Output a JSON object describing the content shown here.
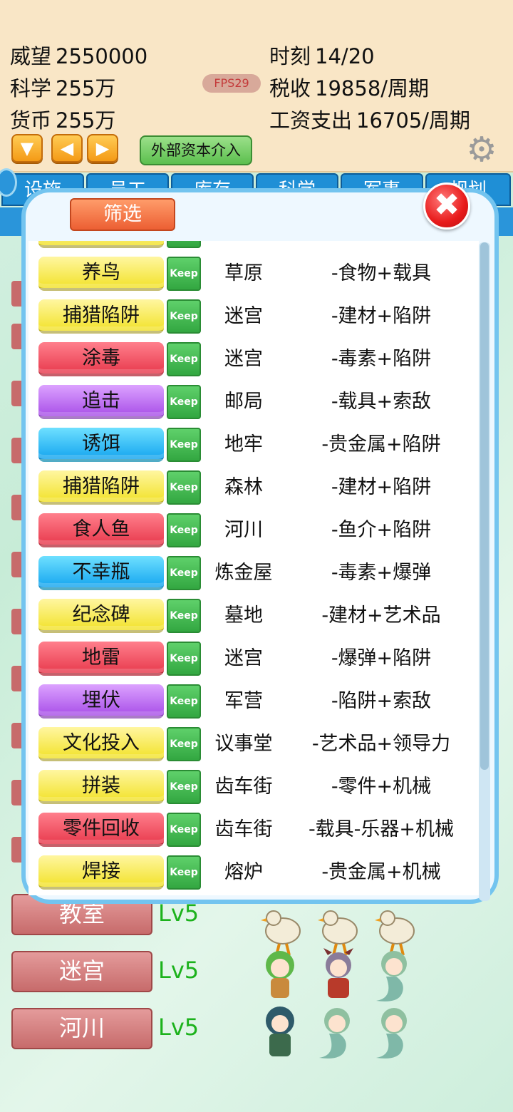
{
  "stats": {
    "prestige_label": "威望",
    "prestige_value": "2550000",
    "time_label": "时刻",
    "time_value": "14/20",
    "science_label": "科学",
    "science_value": "255万",
    "tax_label": "税收",
    "tax_value": "19858/周期",
    "currency_label": "货币",
    "currency_value": "255万",
    "wage_label": "工资支出",
    "wage_value": "16705/周期",
    "fps": "FPS29"
  },
  "controls": {
    "down_arrow": "▼",
    "left_arrow": "◀",
    "right_arrow": "▶",
    "external_capital": "外部资本介入",
    "gear": "⚙"
  },
  "tabs": [
    "设施",
    "员工",
    "库存",
    "科学",
    "军事",
    "规划"
  ],
  "modal": {
    "filter_label": "筛选",
    "close_glyph": "✖",
    "keep_label": "Keep",
    "rows": [
      {
        "name": "养鸟",
        "color": "yellow",
        "location": "草原",
        "effect": "-食物+载具"
      },
      {
        "name": "捕猎陷阱",
        "color": "yellow",
        "location": "迷宫",
        "effect": "-建材+陷阱"
      },
      {
        "name": "涂毒",
        "color": "red",
        "location": "迷宫",
        "effect": "-毒素+陷阱"
      },
      {
        "name": "追击",
        "color": "purple",
        "location": "邮局",
        "effect": "-载具+索敌"
      },
      {
        "name": "诱饵",
        "color": "blue",
        "location": "地牢",
        "effect": "-贵金属+陷阱"
      },
      {
        "name": "捕猎陷阱",
        "color": "yellow",
        "location": "森林",
        "effect": "-建材+陷阱"
      },
      {
        "name": "食人鱼",
        "color": "red",
        "location": "河川",
        "effect": "-鱼介+陷阱"
      },
      {
        "name": "不幸瓶",
        "color": "blue",
        "location": "炼金屋",
        "effect": "-毒素+爆弹"
      },
      {
        "name": "纪念碑",
        "color": "yellow",
        "location": "墓地",
        "effect": "-建材+艺术品"
      },
      {
        "name": "地雷",
        "color": "red",
        "location": "迷宫",
        "effect": "-爆弹+陷阱"
      },
      {
        "name": "埋伏",
        "color": "purple",
        "location": "军营",
        "effect": "-陷阱+索敌"
      },
      {
        "name": "文化投入",
        "color": "yellow",
        "location": "议事堂",
        "effect": "-艺术品+领导力"
      },
      {
        "name": "拼装",
        "color": "yellow",
        "location": "齿车街",
        "effect": "-零件+机械"
      },
      {
        "name": "零件回收",
        "color": "red",
        "location": "齿车街",
        "effect": "-载具-乐器+机械"
      },
      {
        "name": "焊接",
        "color": "yellow",
        "location": "熔炉",
        "effect": "-贵金属+机械"
      }
    ]
  },
  "background_list": [
    {
      "name": "教室",
      "level": "Lv5"
    },
    {
      "name": "迷宫",
      "level": "Lv5"
    },
    {
      "name": "河川",
      "level": "Lv5"
    }
  ],
  "colors": {
    "yellow": "#f2e22a",
    "red": "#e83a4d",
    "purple": "#a84fe8",
    "blue": "#15a5ef",
    "keep_green": "#33a741",
    "tab_blue": "#1f8fd6",
    "modal_border": "#73c4ef"
  }
}
